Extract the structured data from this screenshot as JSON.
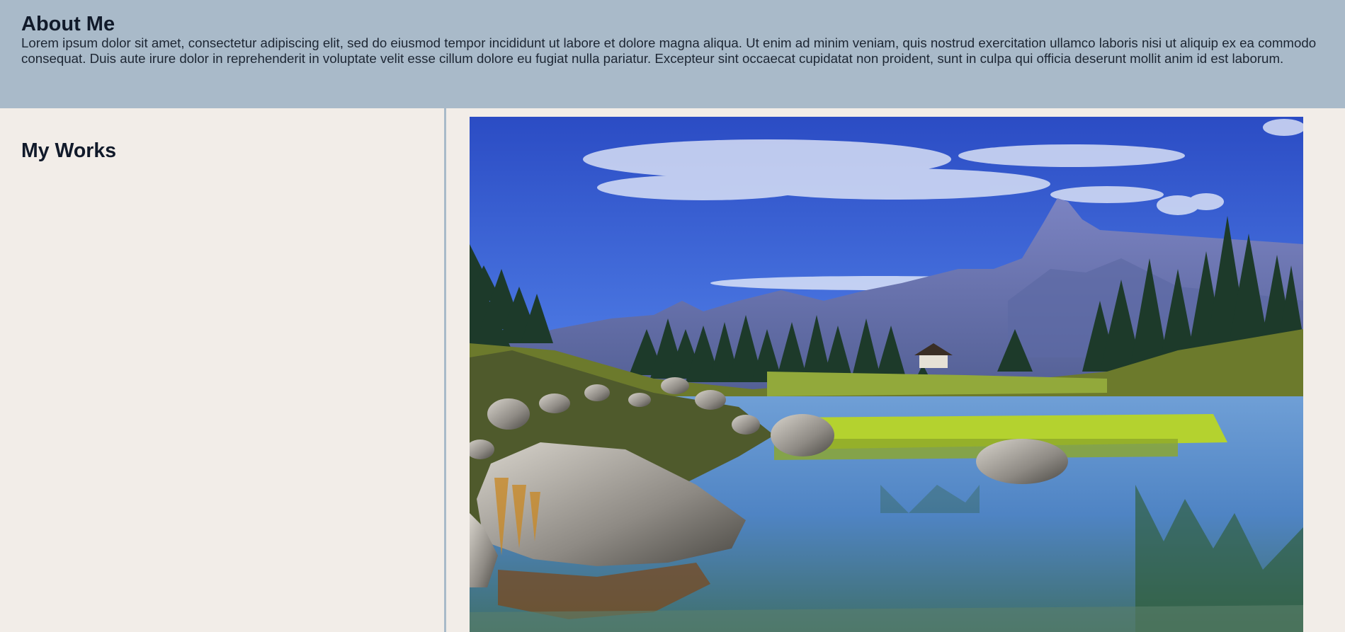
{
  "header": {
    "title": "About Me",
    "body": "Lorem ipsum dolor sit amet, consectetur adipiscing elit, sed do eiusmod tempor incididunt ut labore et dolore magna aliqua. Ut enim ad minim veniam, quis nostrud exercitation ullamco laboris nisi ut aliquip ex ea commodo consequat. Duis aute irure dolor in reprehenderit in voluptate velit esse cillum dolore eu fugiat nulla pariatur. Excepteur sint occaecat cupidatat non proident, sunt in culpa qui officia deserunt mollit anim id est laborum."
  },
  "works": {
    "title": "My Works"
  },
  "colors": {
    "header_bg": "#a9bac9",
    "page_bg": "#f2ede8",
    "text": "#111a2a"
  },
  "image": {
    "subject": "mountain-lake-landscape"
  }
}
